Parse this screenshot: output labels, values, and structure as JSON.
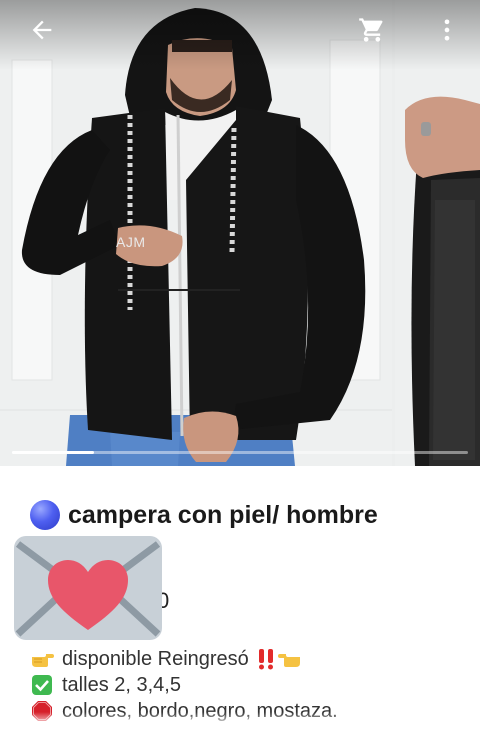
{
  "carousel": {
    "watermark_text": "AJM",
    "progress_fraction": 0.18,
    "slide_count_visible": 2
  },
  "toolbar": {
    "back_icon": "arrow-left-icon",
    "cart_icon": "cart-icon",
    "more_icon": "more-vertical-icon"
  },
  "listing": {
    "title_icon": "blue-circle-icon",
    "title": "campera con piel/ hombre",
    "price_partial": "0",
    "description": [
      {
        "icon": "pointing-right-hand-icon",
        "text": "disponible Reingresó",
        "extra": [
          "double-exclamation-icon",
          "pointing-left-hand-icon"
        ]
      },
      {
        "icon": "check-box-icon",
        "text": "talles 2, 3,4,5",
        "extra": []
      },
      {
        "icon": "stop-sign-icon",
        "text": "colores, bordo,negro, mostaza.",
        "extra": []
      }
    ]
  },
  "overlay": {
    "icon": "love-letter-icon"
  },
  "colors": {
    "jacket": "#151515",
    "accent_blue": "#3d4fe6",
    "heart": "#e8566a",
    "envelope": "#c8d0d7",
    "check_green": "#3fb950",
    "stop_red": "#d6202a"
  }
}
